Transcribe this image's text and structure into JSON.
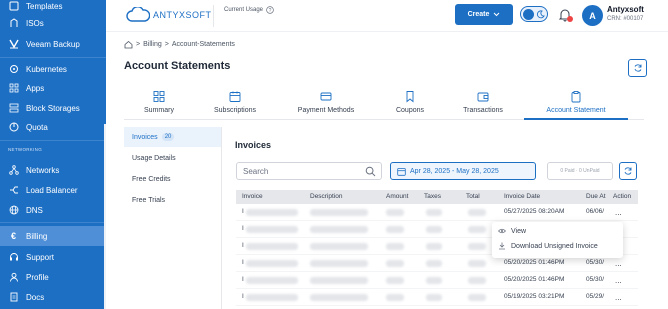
{
  "sidebar": {
    "items_top": [
      {
        "label": "Templates",
        "icon": "template-icon"
      },
      {
        "label": "ISOs",
        "icon": "disc-icon"
      },
      {
        "label": "Veeam Backup",
        "icon": "veeam-icon"
      },
      {
        "label": "Kubernetes",
        "icon": "kubernetes-icon"
      },
      {
        "label": "Apps",
        "icon": "apps-icon"
      },
      {
        "label": "Block Storages",
        "icon": "storage-icon"
      },
      {
        "label": "Quota",
        "icon": "quota-icon"
      }
    ],
    "section_networking": "NETWORKING",
    "items_net": [
      {
        "label": "Networks",
        "icon": "network-icon"
      },
      {
        "label": "Load Balancer",
        "icon": "load-balancer-icon"
      },
      {
        "label": "DNS",
        "icon": "globe-icon"
      }
    ],
    "items_bottom": [
      {
        "label": "Billing",
        "icon": "euro-icon"
      },
      {
        "label": "Support",
        "icon": "headset-icon"
      },
      {
        "label": "Profile",
        "icon": "user-icon"
      },
      {
        "label": "Docs",
        "icon": "docs-icon"
      }
    ]
  },
  "header": {
    "logo_text": "ANTYXSOFT",
    "current_usage": "Current Usage",
    "create_label": "Create",
    "avatar_initial": "A",
    "user_name": "Antyxsoft",
    "user_crn": "CRN: #00107"
  },
  "breadcrumb": {
    "billing": "Billing",
    "current": "Account-Statements"
  },
  "page_title": "Account Statements",
  "tabs": [
    {
      "label": "Summary",
      "icon": "grid-icon"
    },
    {
      "label": "Subscriptions",
      "icon": "calendar-icon"
    },
    {
      "label": "Payment Methods",
      "icon": "credit-card-icon"
    },
    {
      "label": "Coupons",
      "icon": "bookmark-icon"
    },
    {
      "label": "Transactions",
      "icon": "wallet-icon"
    },
    {
      "label": "Account Statement",
      "icon": "clipboard-icon"
    }
  ],
  "subnav": {
    "invoices": "Invoices",
    "invoices_count": "20",
    "usage_details": "Usage Details",
    "free_credits": "Free Credits",
    "free_trials": "Free Trials"
  },
  "invoices": {
    "title": "Invoices",
    "search_placeholder": "Search",
    "date_range": "Apr 28, 2025 - May 28, 2025",
    "paid_label": "0 Paid · 0 UnPaid",
    "columns": [
      "Invoice",
      "Description",
      "Amount",
      "Taxes",
      "Total",
      "Invoice Date",
      "Due At",
      "Action"
    ],
    "rows": [
      {
        "invoice": "I",
        "date": "05/27/2025 08:20AM",
        "due": "06/06/",
        "action": "..."
      },
      {
        "invoice": "I",
        "date": "",
        "due": "",
        "action": ""
      },
      {
        "invoice": "I",
        "date": "",
        "due": "",
        "action": ""
      },
      {
        "invoice": "I",
        "date": "05/20/2025 01:46PM",
        "due": "05/30/",
        "action": "..."
      },
      {
        "invoice": "I",
        "date": "05/20/2025 01:46PM",
        "due": "05/30/",
        "action": "..."
      },
      {
        "invoice": "I",
        "date": "05/19/2025 03:21PM",
        "due": "05/29/",
        "action": "..."
      }
    ]
  },
  "context_menu": {
    "view": "View",
    "download": "Download Unsigned Invoice"
  },
  "colors": {
    "primary": "#1d6fc4",
    "sidebar": "#1d6fc4",
    "badge_red": "#ef4444"
  }
}
